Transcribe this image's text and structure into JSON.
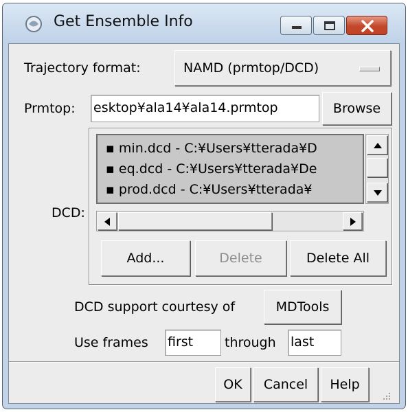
{
  "window": {
    "title": "Get Ensemble Info"
  },
  "trajectory": {
    "label": "Trajectory format:",
    "value": "NAMD (prmtop/DCD)"
  },
  "prmtop": {
    "label": "Prmtop:",
    "value": "esktop¥ala14¥ala14.prmtop",
    "browse_label": "Browse"
  },
  "dcd": {
    "label": "DCD:",
    "files": [
      "min.dcd - C:¥Users¥tterada¥D",
      "eq.dcd - C:¥Users¥tterada¥De",
      "prod.dcd - C:¥Users¥tterada¥"
    ],
    "add_label": "Add...",
    "delete_label": "Delete",
    "delete_all_label": "Delete All"
  },
  "courtesy": {
    "text": "DCD support courtesy of",
    "button_label": "MDTools"
  },
  "frames": {
    "label": "Use frames",
    "first_value": "first",
    "through_label": "through",
    "last_value": "last"
  },
  "buttons": {
    "ok": "OK",
    "cancel": "Cancel",
    "help": "Help"
  }
}
